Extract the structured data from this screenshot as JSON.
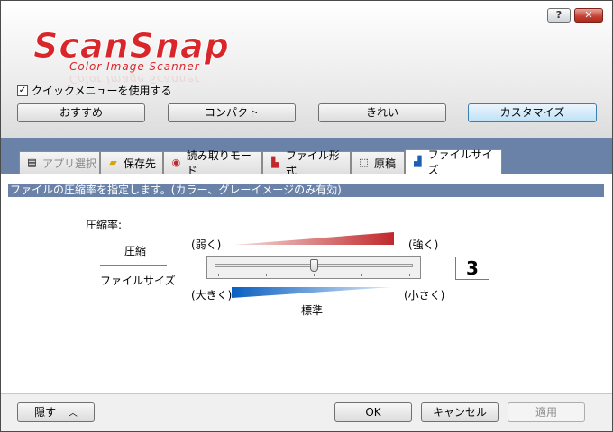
{
  "window": {
    "help_label": "?",
    "close_label": "✕"
  },
  "logo": {
    "main": "ScanSnap",
    "sub": "Color Image Scanner"
  },
  "quick_menu": {
    "checked": true,
    "label": "クイックメニューを使用する"
  },
  "profiles": [
    {
      "label": "おすすめ",
      "selected": false
    },
    {
      "label": "コンパクト",
      "selected": false
    },
    {
      "label": "きれい",
      "selected": false
    },
    {
      "label": "カスタマイズ",
      "selected": true
    }
  ],
  "tabs": [
    {
      "label": "アプリ選択",
      "icon": "app-select-icon",
      "disabled": true
    },
    {
      "label": "保存先",
      "icon": "folder-icon"
    },
    {
      "label": "読み取りモード",
      "icon": "scan-mode-icon"
    },
    {
      "label": "ファイル形式",
      "icon": "file-format-icon"
    },
    {
      "label": "原稿",
      "icon": "document-icon"
    },
    {
      "label": "ファイルサイズ",
      "icon": "file-size-icon",
      "active": true
    }
  ],
  "panel": {
    "description": "ファイルの圧縮率を指定します。(カラー、グレーイメージのみ有効)",
    "compression_rate_label": "圧縮率:",
    "compression_label": "圧縮",
    "filesize_label": "ファイルサイズ",
    "weak_label": "(弱く)",
    "strong_label": "(強く)",
    "large_label": "(大きく)",
    "small_label": "(小さく)",
    "standard_label": "標準",
    "value": "3",
    "slider": {
      "min": 1,
      "max": 5,
      "value": 3
    }
  },
  "colors": {
    "accent_blue": "#6b82a8",
    "logo_red": "#d9262a",
    "wedge_red": "#c0282c",
    "wedge_blue": "#0a5fc0"
  },
  "footer": {
    "hide_label": "隠す",
    "ok_label": "OK",
    "cancel_label": "キャンセル",
    "apply_label": "適用"
  }
}
